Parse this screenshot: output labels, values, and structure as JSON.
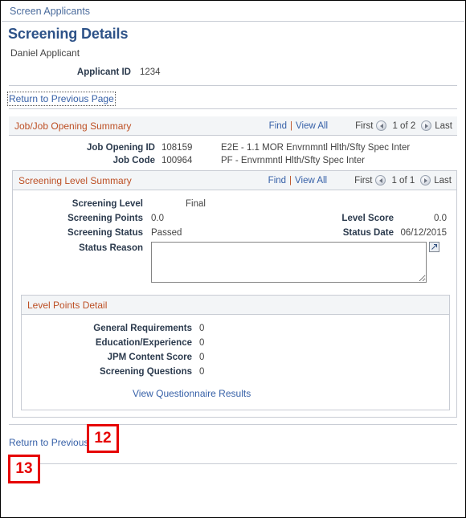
{
  "breadcrumb": {
    "label": "Screen Applicants"
  },
  "header": {
    "title": "Screening Details",
    "applicant_name": "Daniel Applicant",
    "applicant_id_label": "Applicant ID",
    "applicant_id_value": "1234"
  },
  "return_link_top": "Return to Previous Page",
  "return_link_bottom": "Return to Previous Page",
  "job_summary": {
    "title": "Job/Job Opening Summary",
    "find_label": "Find",
    "pipe": "|",
    "view_all_label": "View All",
    "first_label": "First",
    "counter": "1 of 2",
    "last_label": "Last",
    "rows": [
      {
        "label": "Job Opening ID",
        "value": "108159",
        "description": "E2E - 1.1 MOR Envrnmntl Hlth/Sfty Spec Inter"
      },
      {
        "label": "Job Code",
        "value": "100964",
        "description": "PF - Envrnmntl Hlth/Sfty Spec Inter"
      }
    ]
  },
  "level_summary": {
    "title": "Screening Level Summary",
    "find_label": "Find",
    "pipe": "|",
    "view_all_label": "View All",
    "first_label": "First",
    "counter": "1 of 1",
    "last_label": "Last",
    "screening_level_label": "Screening Level",
    "screening_level_value": "Final",
    "screening_points_label": "Screening Points",
    "screening_points_value": "0.0",
    "level_score_label": "Level Score",
    "level_score_value": "0.0",
    "screening_status_label": "Screening Status",
    "screening_status_value": "Passed",
    "status_date_label": "Status Date",
    "status_date_value": "06/12/2015",
    "status_reason_label": "Status Reason",
    "status_reason_value": "",
    "status_reason_placeholder": ""
  },
  "level_points_detail": {
    "title": "Level Points Detail",
    "rows": [
      {
        "label": "General Requirements",
        "value": "0"
      },
      {
        "label": "Education/Experience",
        "value": "0"
      },
      {
        "label": "JPM Content Score",
        "value": "0"
      },
      {
        "label": "Screening Questions",
        "value": "0"
      }
    ],
    "questionnaire_link": "View Questionnaire Results"
  },
  "callouts": [
    {
      "number": "12"
    },
    {
      "number": "13"
    }
  ],
  "colors": {
    "group_header_text": "#bd4f24",
    "link": "#3761a8",
    "page_title": "#2d5288",
    "callout_red": "#e60000",
    "label_text": "#2b3a4d"
  }
}
